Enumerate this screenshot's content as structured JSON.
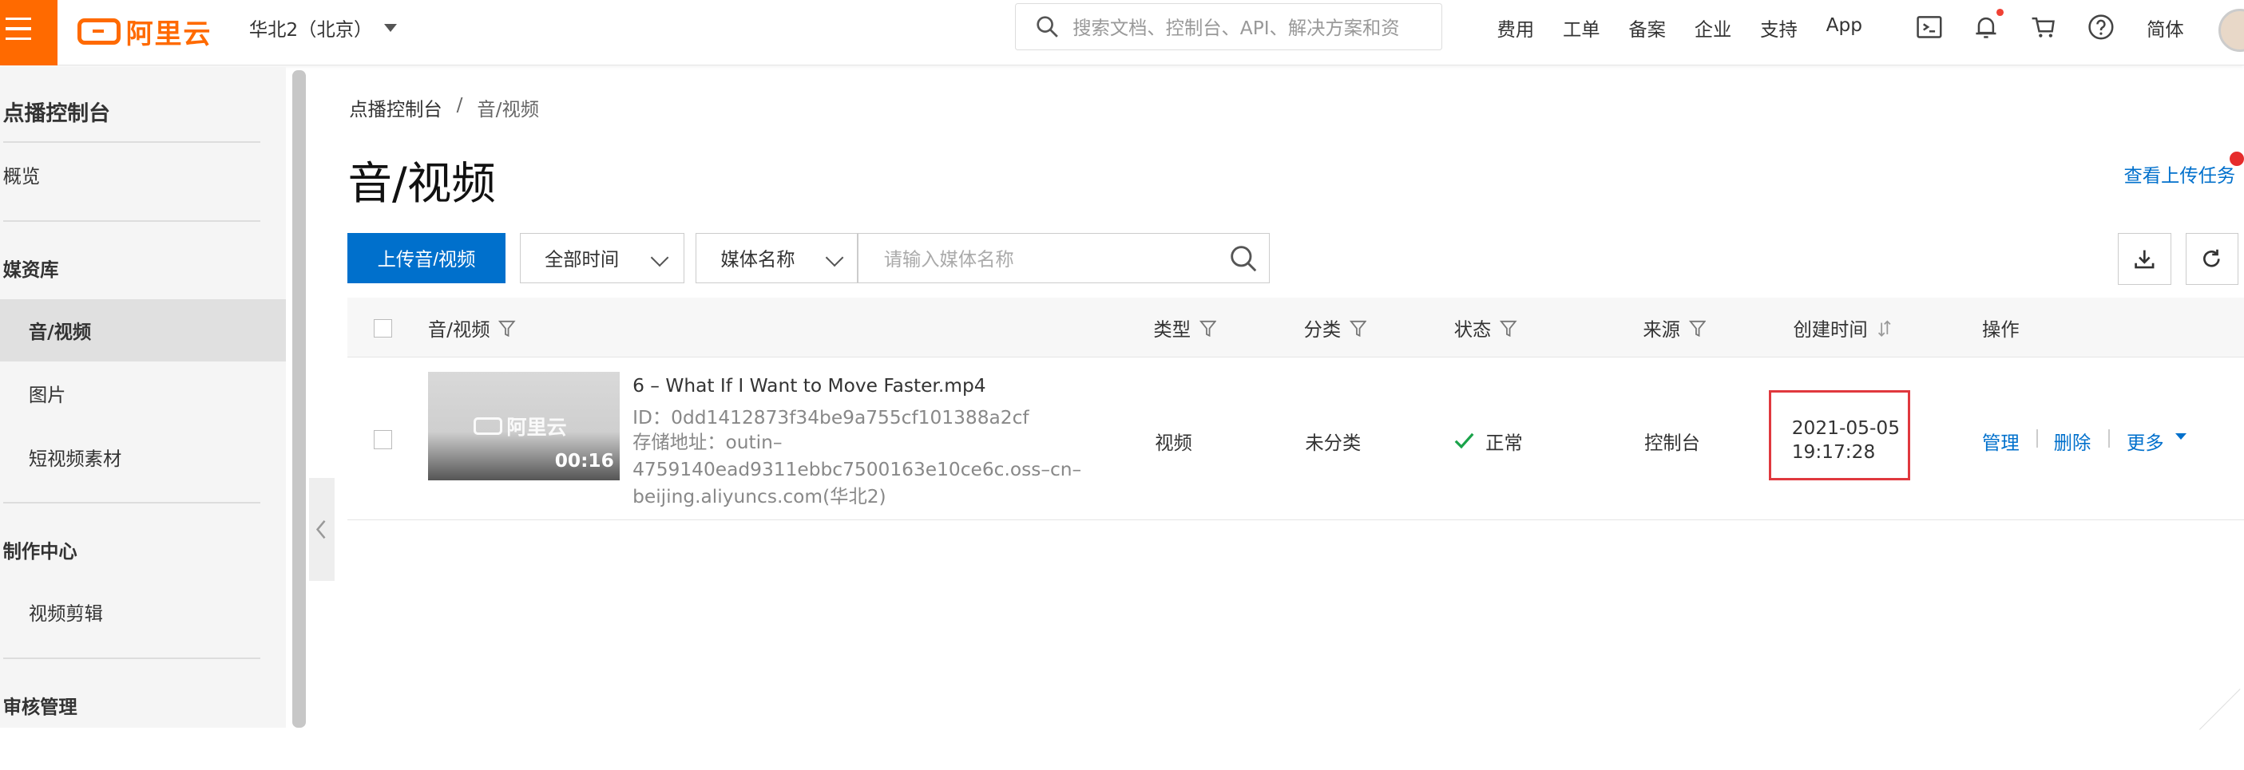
{
  "header": {
    "logo_text": "阿里云",
    "region": "华北2（北京）",
    "search_placeholder": "搜索文档、控制台、API、解决方案和资",
    "nav_links": [
      "费用",
      "工单",
      "备案",
      "企业",
      "支持",
      "App"
    ],
    "icons": [
      "terminal-icon",
      "bell-icon",
      "cart-icon",
      "help-icon"
    ],
    "language": "简体"
  },
  "sidebar": {
    "title": "点播控制台",
    "overview": "概览",
    "groups": [
      {
        "label": "媒资库",
        "items": [
          "音/视频",
          "图片",
          "短视频素材"
        ],
        "active": "音/视频"
      },
      {
        "label": "制作中心",
        "items": [
          "视频剪辑"
        ]
      },
      {
        "label": "审核管理",
        "items": []
      }
    ]
  },
  "breadcrumb": {
    "root": "点播控制台",
    "sep": "/",
    "current": "音/视频"
  },
  "page": {
    "title": "音/视频",
    "upload_tasks_link": "查看上传任务"
  },
  "toolbar": {
    "upload_button": "上传音/视频",
    "time_filter": "全部时间",
    "field_select": "媒体名称",
    "search_placeholder": "请输入媒体名称"
  },
  "table": {
    "headers": [
      "音/视频",
      "类型",
      "分类",
      "状态",
      "来源",
      "创建时间",
      "操作"
    ],
    "rows": [
      {
        "thumb_logo": "阿里云",
        "duration": "00:16",
        "file_name": "6 – What If I Want to Move Faster.mp4",
        "id_line": "ID：0dd1412873f34be9a755cf101388a2cf",
        "address_line": "存储地址：outin–4759140ead9311ebbc7500163e10ce6c.oss–cn–beijing.aliyuncs.com(华北2)",
        "type": "视频",
        "category": "未分类",
        "status": "正常",
        "source": "控制台",
        "created_date": "2021-05-05",
        "created_time": "19:17:28",
        "actions": [
          "管理",
          "删除",
          "更多"
        ]
      }
    ]
  },
  "colors": {
    "brand": "#ff6a00",
    "primary": "#0070cc",
    "highlight": "#e0383e",
    "success": "#1aa34a"
  }
}
